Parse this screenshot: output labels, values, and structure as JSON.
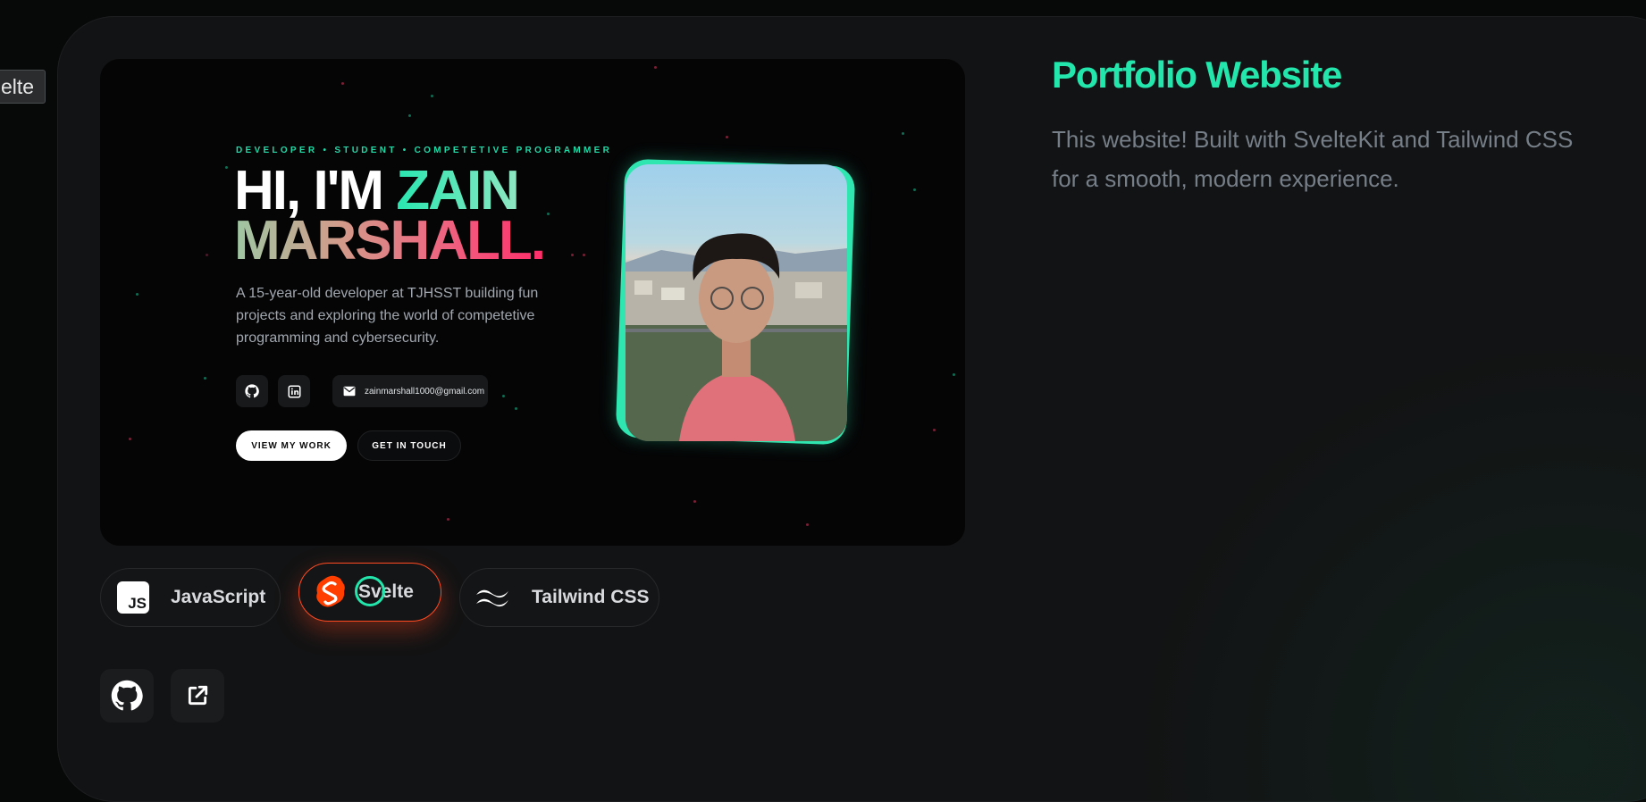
{
  "tooltip": {
    "text": "elte"
  },
  "project": {
    "title": "Portfolio Website",
    "description": "This website! Built with SvelteKit and Tailwind CSS for a smooth, modern experience."
  },
  "preview": {
    "tagline": "DEVELOPER • STUDENT • COMPETETIVE PROGRAMMER",
    "hero_line1": "HI, I'M ",
    "hero_name_first": "ZAIN",
    "hero_line2": "MARSHALL.",
    "bio": "A 15-year-old developer at TJHSST building fun projects and exploring the world of competetive programming and cybersecurity.",
    "email": "zainmarshall1000@gmail.com",
    "primary_button": "VIEW MY WORK",
    "secondary_button": "GET IN TOUCH"
  },
  "tech_stack": [
    {
      "label": "JavaScript",
      "icon": "javascript-icon"
    },
    {
      "label": "Svelte",
      "icon": "svelte-icon",
      "active": true
    },
    {
      "label": "Tailwind CSS",
      "icon": "tailwind-icon"
    }
  ],
  "links": {
    "github_icon": "github-icon",
    "external_icon": "external-link-icon"
  },
  "colors": {
    "accent": "#23e6ad",
    "svelte": "#ff3e00",
    "card": "#121314",
    "text_muted": "#767e88"
  }
}
